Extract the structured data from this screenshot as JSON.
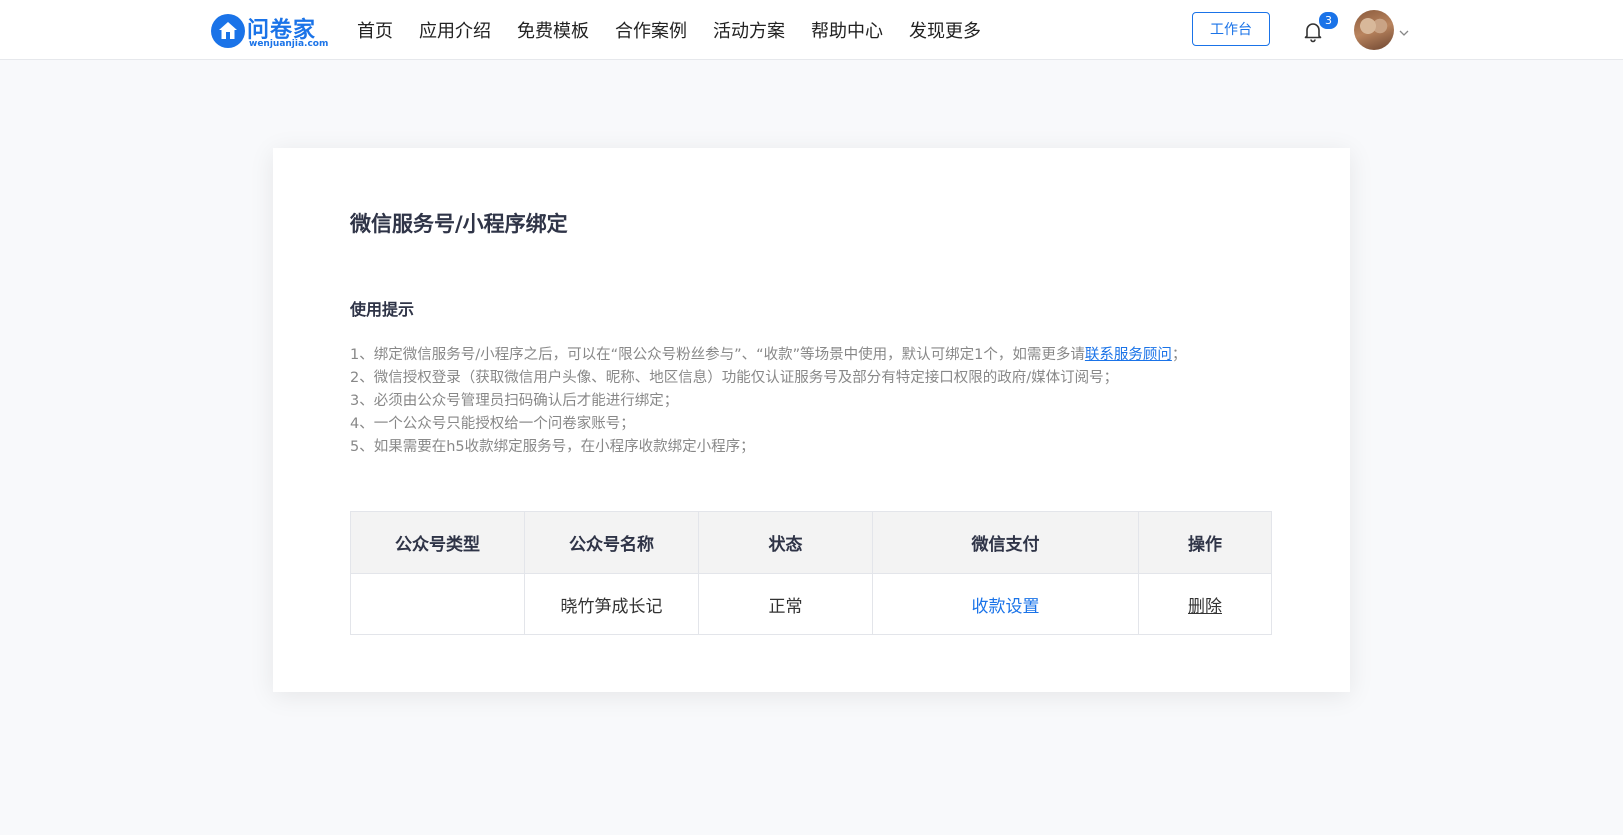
{
  "header": {
    "logo_text": "问卷家",
    "logo_sub": "wenjuanjia.com",
    "nav": [
      {
        "label": "首页"
      },
      {
        "label": "应用介绍"
      },
      {
        "label": "免费模板"
      },
      {
        "label": "合作案例"
      },
      {
        "label": "活动方案"
      },
      {
        "label": "帮助中心"
      },
      {
        "label": "发现更多"
      }
    ],
    "workbench_label": "工作台",
    "notification_count": "3",
    "icons": {
      "bell": "bell-icon",
      "avatar": "user-avatar",
      "caret": "chevron-down-icon"
    }
  },
  "main": {
    "title": "微信服务号/小程序绑定",
    "tips_title": "使用提示",
    "tips": {
      "line1_before": "1、绑定微信服务号/小程序之后，可以在“限公众号粉丝参与”、“收款”等场景中使用，默认可绑定1个，如需更多请",
      "line1_link": "联系服务顾问",
      "line1_after": "；",
      "line2": "2、微信授权登录（获取微信用户头像、昵称、地区信息）功能仅认证服务号及部分有特定接口权限的政府/媒体订阅号；",
      "line3": "3、必须由公众号管理员扫码确认后才能进行绑定；",
      "line4": "4、一个公众号只能授权给一个问卷家账号；",
      "line5": "5、如果需要在h5收款绑定服务号，在小程序收款绑定小程序；"
    },
    "table": {
      "headers": [
        "公众号类型",
        "公众号名称",
        "状态",
        "微信支付",
        "操作"
      ],
      "rows": [
        {
          "type": "",
          "name": "晓竹笋成长记",
          "status": "正常",
          "pay": "收款设置",
          "action": "删除"
        }
      ]
    }
  },
  "colors": {
    "accent": "#1a73e8",
    "title": "#2f3447",
    "tip": "#888888"
  }
}
